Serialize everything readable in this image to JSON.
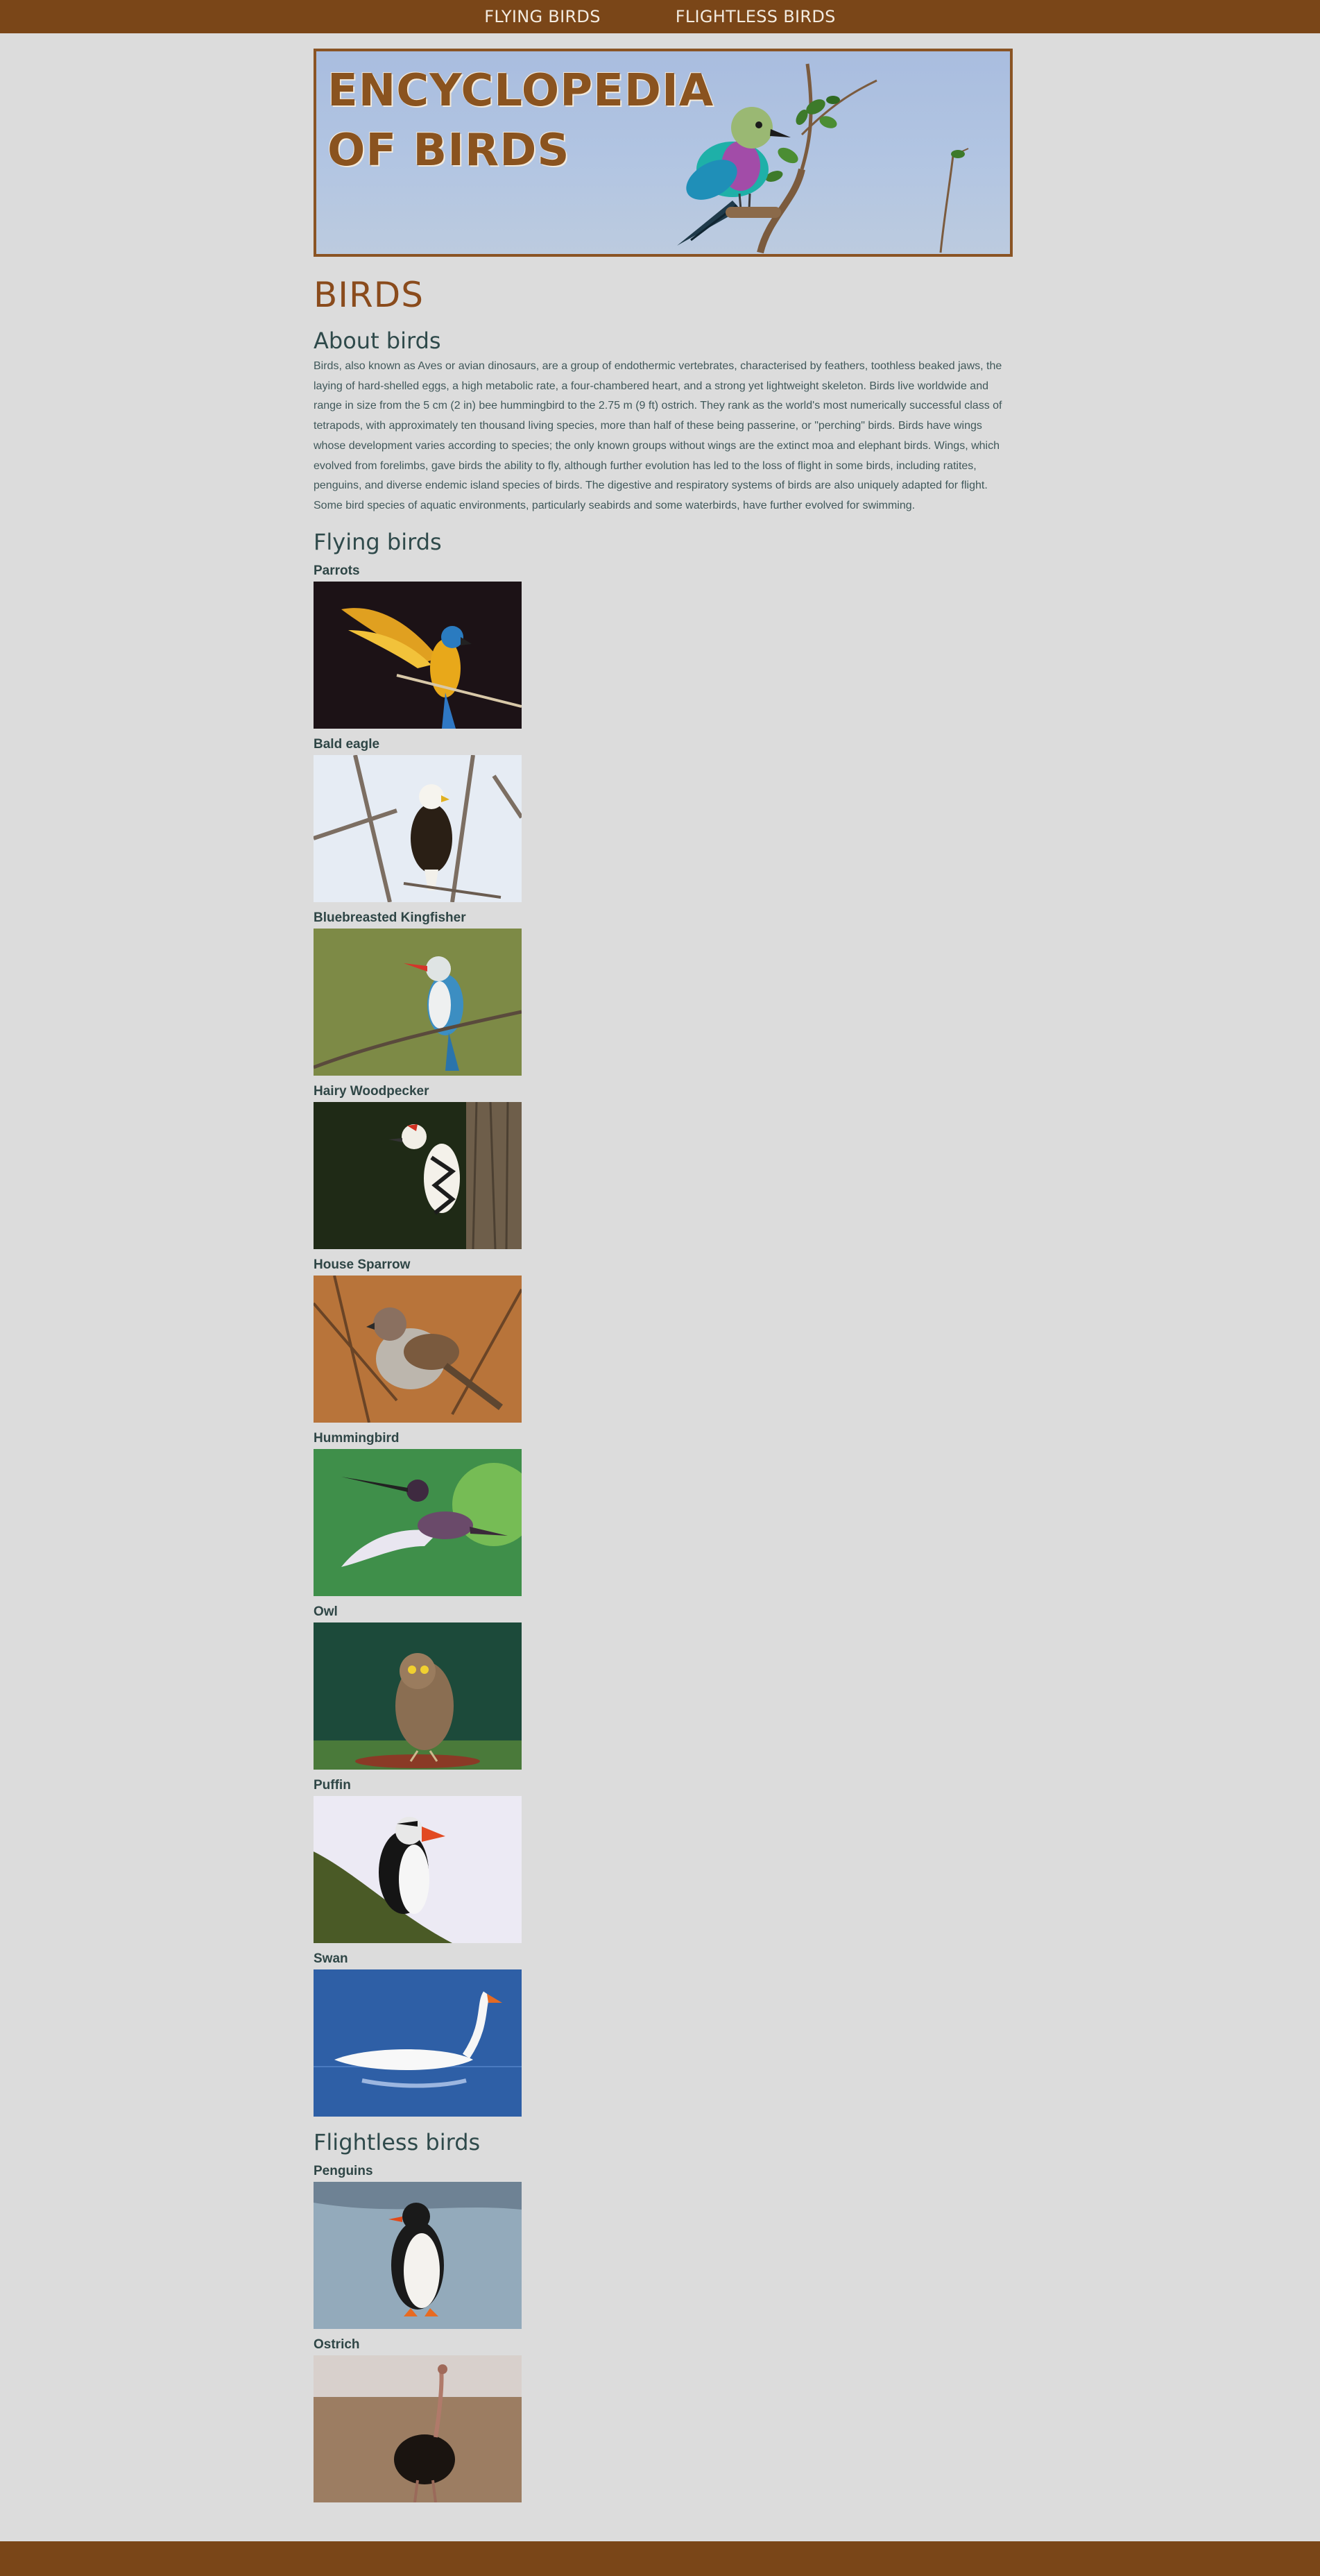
{
  "nav": {
    "items": [
      {
        "label": "FLYING BIRDS"
      },
      {
        "label": "FLIGHTLESS BIRDS"
      }
    ]
  },
  "banner": {
    "line1": "ENCYCLOPEDIA",
    "line2": "OF BIRDS"
  },
  "page_title": "BIRDS",
  "about": {
    "heading": "About birds",
    "text": "Birds, also known as Aves or avian dinosaurs, are a group of endothermic vertebrates, characterised by feathers, toothless beaked jaws, the laying of hard-shelled eggs, a high metabolic rate, a four-chambered heart, and a strong yet lightweight skeleton. Birds live worldwide and range in size from the 5 cm (2 in) bee hummingbird to the 2.75 m (9 ft) ostrich. They rank as the world's most numerically successful class of tetrapods, with approximately ten thousand living species, more than half of these being passerine, or \"perching\" birds. Birds have wings whose development varies according to species; the only known groups without wings are the extinct moa and elephant birds. Wings, which evolved from forelimbs, gave birds the ability to fly, although further evolution has led to the loss of flight in some birds, including ratites, penguins, and diverse endemic island species of birds. The digestive and respiratory systems of birds are also uniquely adapted for flight. Some bird species of aquatic environments, particularly seabirds and some waterbirds, have further evolved for swimming."
  },
  "flying": {
    "heading": "Flying birds",
    "birds": [
      {
        "name": "Parrots"
      },
      {
        "name": "Bald eagle"
      },
      {
        "name": "Bluebreasted Kingfisher"
      },
      {
        "name": "Hairy Woodpecker"
      },
      {
        "name": "House Sparrow"
      },
      {
        "name": "Hummingbird"
      },
      {
        "name": "Owl"
      },
      {
        "name": "Puffin"
      },
      {
        "name": "Swan"
      }
    ]
  },
  "flightless": {
    "heading": "Flightless birds",
    "birds": [
      {
        "name": "Penguins"
      },
      {
        "name": "Ostrich"
      }
    ]
  },
  "colors": {
    "brand": "#7a4618",
    "background": "#dcdcdc",
    "heading": "#2f4a4b",
    "title": "#8a4b1c"
  }
}
